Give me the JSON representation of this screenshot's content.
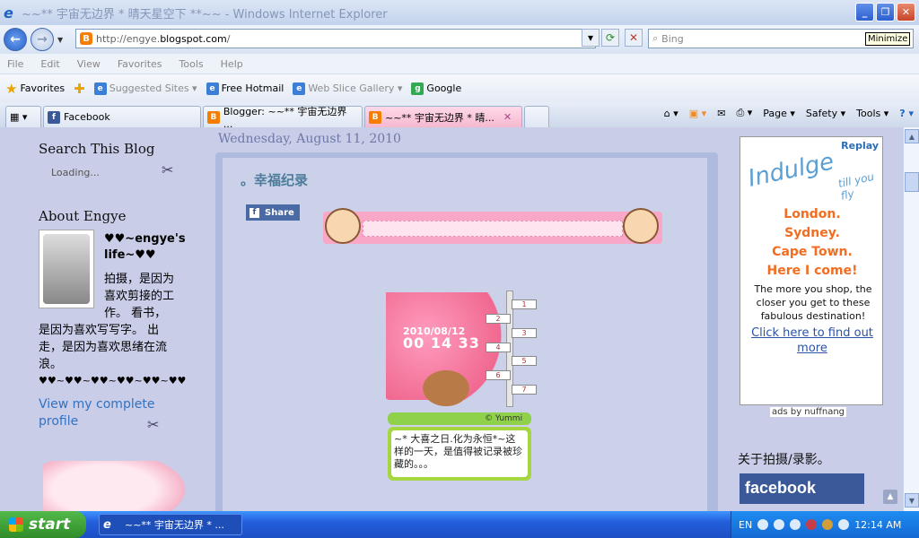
{
  "window": {
    "title": "~~** 宇宙无边界 * 晴天星空下 **~~ - Windows Internet Explorer",
    "minimize_tooltip": "Minimize"
  },
  "nav": {
    "address": "http://engye.blogspot.com/",
    "address_prefix": "http://engye.",
    "address_domain": "blogspot.com",
    "address_suffix": "/",
    "search_placeholder": "Bing"
  },
  "menu": [
    "File",
    "Edit",
    "View",
    "Favorites",
    "Tools",
    "Help"
  ],
  "favorites_bar": {
    "favorites_label": "Favorites",
    "items": [
      {
        "label": "Suggested Sites ▾",
        "dim": true
      },
      {
        "label": "Free Hotmail",
        "dim": false
      },
      {
        "label": "Web Slice Gallery ▾",
        "dim": true
      },
      {
        "label": "Google",
        "dim": false
      }
    ]
  },
  "tabs": [
    {
      "label": "Facebook"
    },
    {
      "label": "Blogger: ~~** 宇宙无边界 ..."
    },
    {
      "label": "~~** 宇宙无边界 * 晴..."
    }
  ],
  "commands": [
    "Page ▾",
    "Safety ▾",
    "Tools ▾"
  ],
  "sidebar": {
    "search_title": "Search This Blog",
    "loading": "Loading...",
    "about_title": "About Engye",
    "profile_name": "♥♥~engye's life~♥♥",
    "profile_desc1": "拍摄，是因为喜欢剪接的工作。 看书，",
    "profile_desc2": "是因为喜欢写写字。 出走，是因为喜欢思绪在流浪。",
    "hearts": "♥♥~♥♥~♥♥~♥♥~♥♥~♥♥",
    "view_profile": "View my complete profile"
  },
  "post": {
    "date": "Wednesday, August 11, 2010",
    "title": "。幸福纪录",
    "share": "Share",
    "counter_date": "2010/08/12",
    "counter_time": "00 14 33",
    "signs": [
      "1",
      "2",
      "3",
      "4",
      "5",
      "6",
      "7"
    ],
    "yummi": "© Yummi",
    "message": "~* 大喜之日.化为永恒*~这样的一天，是值得被记录被珍藏的。。。"
  },
  "ad": {
    "replay": "Replay",
    "indulge": "Indulge",
    "sub": "till you fly",
    "cities": [
      "London.",
      "Sydney.",
      "Cape Town.",
      "Here I come!"
    ],
    "copy": "The more you shop, the closer you get to these fabulous destination!",
    "link": "Click here to find out more",
    "by": "ads by nuffnang"
  },
  "right": {
    "title": "关于拍摄/录影。",
    "facebook": "facebook"
  },
  "taskbar": {
    "start": "start",
    "task": "~~** 宇宙无边界 * ...",
    "lang": "EN",
    "clock": "12:14 AM"
  },
  "colors": {
    "accent": "#2a6db5",
    "page_bg": "#c9cde8",
    "ad_orange": "#f26d21"
  }
}
